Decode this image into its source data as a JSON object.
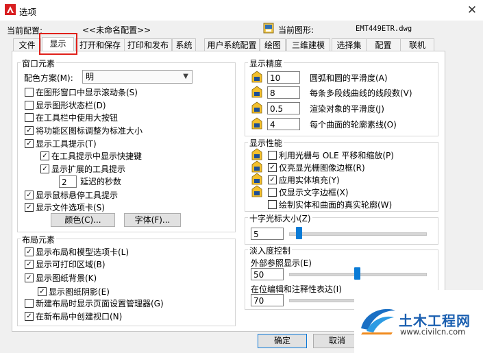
{
  "window": {
    "title": "选项",
    "close_glyph": "✕"
  },
  "profile": {
    "label": "当前配置:",
    "value": "<<未命名配置>>"
  },
  "drawing": {
    "label": "当前图形:",
    "value": "EMT449ETR.dwg"
  },
  "tabs": [
    {
      "label": "文件",
      "active": false
    },
    {
      "label": "显示",
      "active": true
    },
    {
      "label": "打开和保存",
      "active": false
    },
    {
      "label": "打印和发布",
      "active": false
    },
    {
      "label": "系统",
      "active": false
    },
    {
      "label": "用户系统配置",
      "active": false
    },
    {
      "label": "绘图",
      "active": false
    },
    {
      "label": "三维建模",
      "active": false
    },
    {
      "label": "选择集",
      "active": false
    },
    {
      "label": "配置",
      "active": false
    },
    {
      "label": "联机",
      "active": false
    }
  ],
  "window_elements": {
    "title": "窗口元素",
    "color_scheme_label": "配色方案(M):",
    "color_scheme_value": "明",
    "options": [
      {
        "label": "在图形窗口中显示滚动条(S)",
        "checked": false
      },
      {
        "label": "显示图形状态栏(D)",
        "checked": false
      },
      {
        "label": "在工具栏中使用大按钮",
        "checked": false
      },
      {
        "label": "将功能区图标调整为标准大小",
        "checked": true
      },
      {
        "label": "显示工具提示(T)",
        "checked": true
      },
      {
        "label": "在工具提示中显示快捷键",
        "checked": true
      },
      {
        "label": "显示扩展的工具提示",
        "checked": true
      },
      {
        "label": "显示鼠标悬停工具提示",
        "checked": true
      },
      {
        "label": "显示文件选项卡(S)",
        "checked": true
      }
    ],
    "delay_value": "2",
    "delay_label": "延迟的秒数",
    "colors_button": "颜色(C)...",
    "fonts_button": "字体(F)..."
  },
  "layout_elements": {
    "title": "布局元素",
    "options": [
      {
        "label": "显示布局和模型选项卡(L)",
        "checked": true
      },
      {
        "label": "显示可打印区域(B)",
        "checked": true
      },
      {
        "label": "显示图纸背景(K)",
        "checked": true
      },
      {
        "label": "显示图纸阴影(E)",
        "checked": true
      },
      {
        "label": "新建布局时显示页面设置管理器(G)",
        "checked": false
      },
      {
        "label": "在新布局中创建视口(N)",
        "checked": true
      }
    ]
  },
  "display_resolution": {
    "title": "显示精度",
    "rows": [
      {
        "value": "10",
        "label": "圆弧和圆的平滑度(A)"
      },
      {
        "value": "8",
        "label": "每条多段线曲线的线段数(V)"
      },
      {
        "value": "0.5",
        "label": "渲染对象的平滑度(J)"
      },
      {
        "value": "4",
        "label": "每个曲面的轮廓素线(O)"
      }
    ]
  },
  "display_performance": {
    "title": "显示性能",
    "options": [
      {
        "label": "利用光栅与 OLE 平移和缩放(P)",
        "checked": false
      },
      {
        "label": "仅亮显光栅图像边框(R)",
        "checked": true
      },
      {
        "label": "应用实体填充(Y)",
        "checked": true
      },
      {
        "label": "仅显示文字边框(X)",
        "checked": false
      },
      {
        "label": "绘制实体和曲面的真实轮廓(W)",
        "checked": false
      }
    ]
  },
  "crosshair": {
    "title": "十字光标大小(Z)",
    "value": "5",
    "fraction": 0.05
  },
  "fade": {
    "title": "淡入度控制",
    "xref_label": "外部参照显示(E)",
    "xref_value": "50",
    "xref_fraction": 0.5,
    "inplace_label": "在位编辑和注释性表达(I)",
    "inplace_value": "70",
    "inplace_fraction": 0.7
  },
  "buttons": {
    "ok": "确定",
    "cancel": "取消"
  },
  "watermark": {
    "name": "土木工程网",
    "url": "www.civilcn.com"
  },
  "colors": {
    "accent": "#0a7bd6",
    "highlight": "#e0201a"
  }
}
